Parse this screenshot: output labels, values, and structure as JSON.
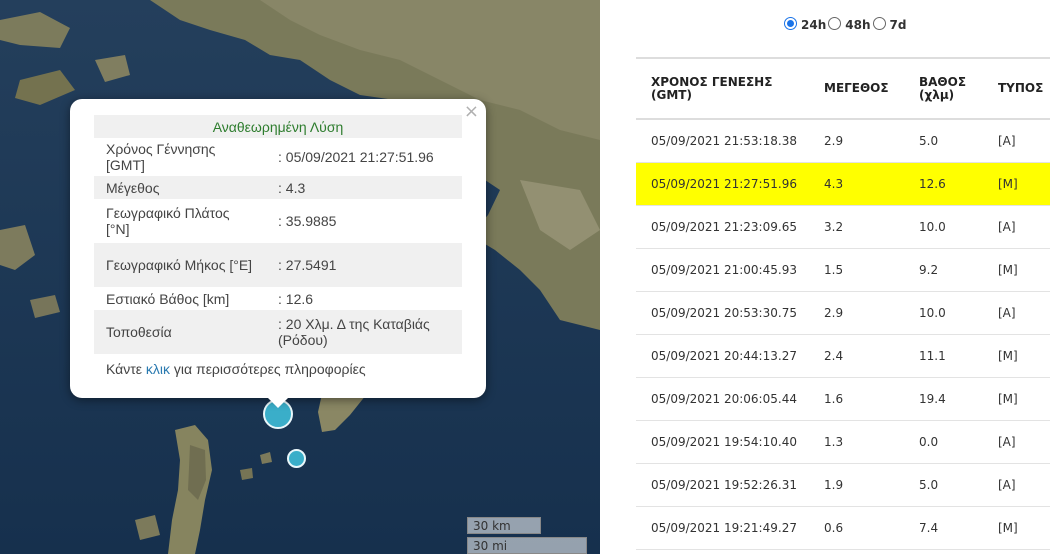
{
  "popup": {
    "title": "Αναθεωρημένη Λύση",
    "rows": [
      {
        "label": "Χρόνος Γέννησης [GMT]",
        "value": ": 05/09/2021 21:27:51.96"
      },
      {
        "label": "Μέγεθος",
        "value": ": 4.3"
      },
      {
        "label": "Γεωγραφικό Πλάτος [°N]",
        "value": ": 35.9885"
      },
      {
        "label": "Γεωγραφικό Μήκος [°E]",
        "value": ": 27.5491"
      },
      {
        "label": "Εστιακό Βάθος [km]",
        "value": ": 12.6"
      },
      {
        "label": "Τοποθεσία",
        "value": ": 20 Χλμ. Δ της Καταβιάς (Ρόδου)"
      }
    ],
    "more_prefix": "Κάντε ",
    "more_link": "κλικ",
    "more_suffix": " για περισσότερες πληροφορίες",
    "close_symbol": "×"
  },
  "map": {
    "scale_km": "30 km",
    "scale_mi": "30 mi",
    "quake_color": "#3aaec9"
  },
  "filters": {
    "options": [
      "24h",
      "48h",
      "7d"
    ],
    "selected": "24h"
  },
  "table": {
    "headers": [
      "ΧΡΟΝΟΣ ΓΕΝΕΣΗΣ (GMT)",
      "ΜΕΓΕΘΟΣ",
      "ΒΑΘΟΣ (χλμ)",
      "ΤΥΠΟΣ"
    ],
    "rows": [
      {
        "time": "05/09/2021 21:53:18.38",
        "mag": "2.9",
        "depth": "5.0",
        "type": "[A]"
      },
      {
        "time": "05/09/2021 21:27:51.96",
        "mag": "4.3",
        "depth": "12.6",
        "type": "[M]",
        "highlighted": true
      },
      {
        "time": "05/09/2021 21:23:09.65",
        "mag": "3.2",
        "depth": "10.0",
        "type": "[A]"
      },
      {
        "time": "05/09/2021 21:00:45.93",
        "mag": "1.5",
        "depth": "9.2",
        "type": "[M]"
      },
      {
        "time": "05/09/2021 20:53:30.75",
        "mag": "2.9",
        "depth": "10.0",
        "type": "[A]"
      },
      {
        "time": "05/09/2021 20:44:13.27",
        "mag": "2.4",
        "depth": "11.1",
        "type": "[M]"
      },
      {
        "time": "05/09/2021 20:06:05.44",
        "mag": "1.6",
        "depth": "19.4",
        "type": "[M]"
      },
      {
        "time": "05/09/2021 19:54:10.40",
        "mag": "1.3",
        "depth": "0.0",
        "type": "[A]"
      },
      {
        "time": "05/09/2021 19:52:26.31",
        "mag": "1.9",
        "depth": "5.0",
        "type": "[A]"
      },
      {
        "time": "05/09/2021 19:21:49.27",
        "mag": "0.6",
        "depth": "7.4",
        "type": "[M]"
      }
    ],
    "highlight_color": "#ffff00",
    "type_colors": {
      "A": "#d63a2f",
      "M": "#2e8b2e"
    }
  }
}
